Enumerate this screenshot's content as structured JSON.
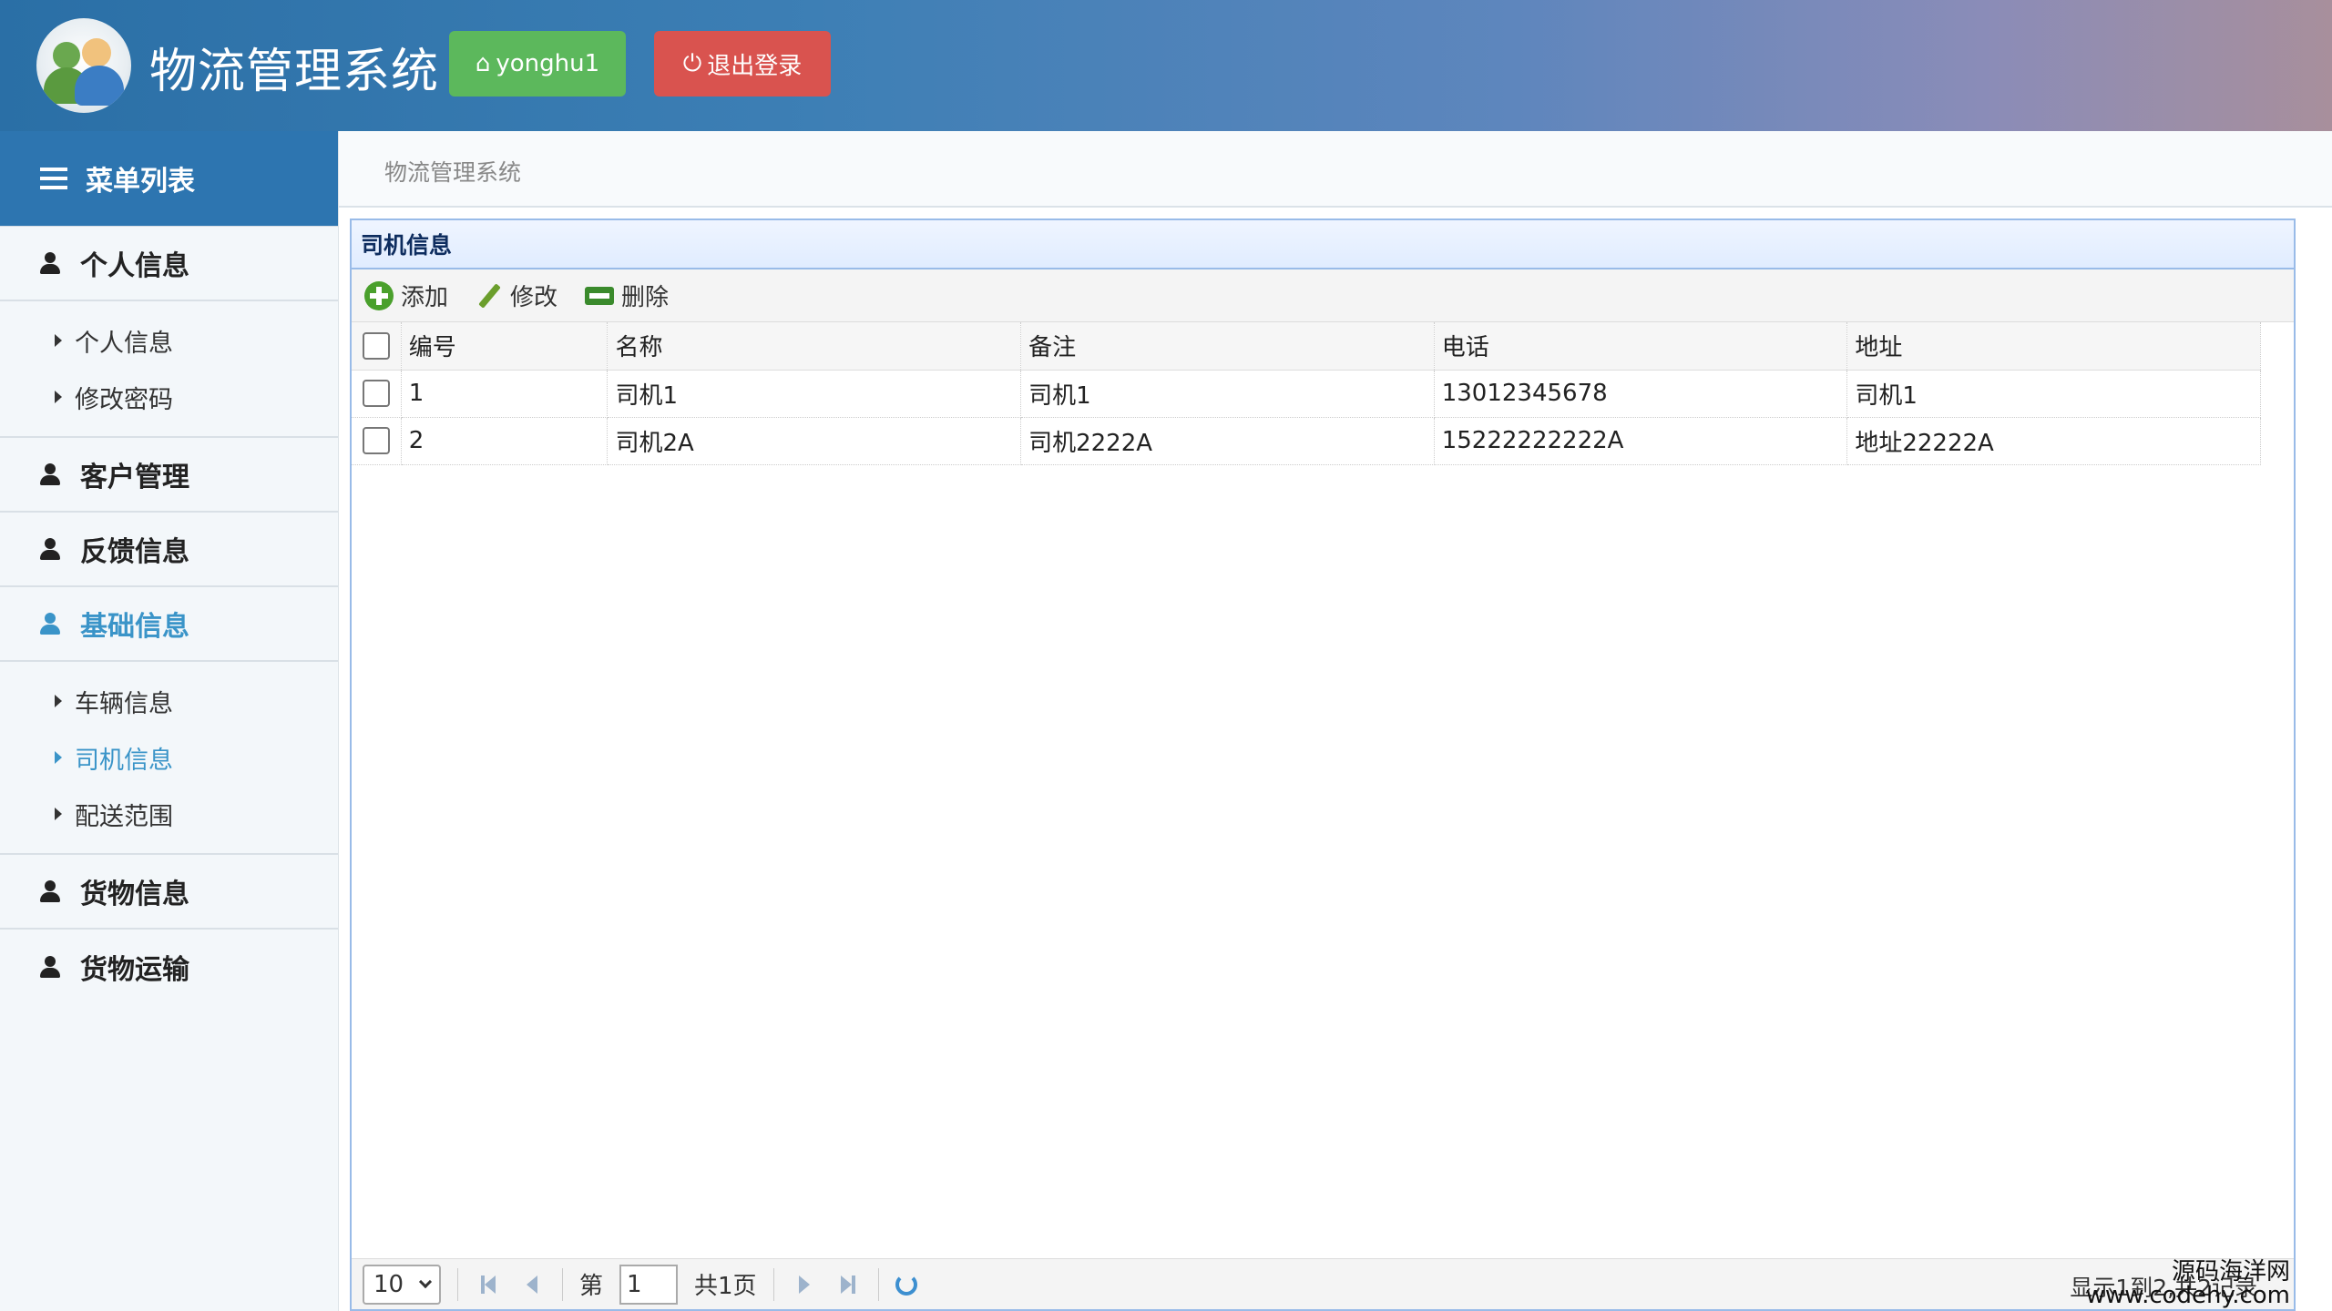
{
  "header": {
    "app_title": "物流管理系统",
    "user_button": "yonghu1",
    "logout_button": "退出登录"
  },
  "sidebar": {
    "menu_title": "菜单列表",
    "groups": [
      {
        "label": "个人信息",
        "items": [
          "个人信息",
          "修改密码"
        ]
      },
      {
        "label": "客户管理"
      },
      {
        "label": "反馈信息"
      },
      {
        "label": "基础信息",
        "active": true,
        "items": [
          "车辆信息",
          "司机信息",
          "配送范围"
        ],
        "active_item": "司机信息"
      },
      {
        "label": "货物信息"
      },
      {
        "label": "货物运输"
      }
    ]
  },
  "breadcrumb": "物流管理系统",
  "panel": {
    "title": "司机信息",
    "toolbar": {
      "add": "添加",
      "edit": "修改",
      "delete": "删除"
    },
    "columns": [
      "编号",
      "名称",
      "备注",
      "电话",
      "地址"
    ],
    "rows": [
      [
        "1",
        "司机1",
        "司机1",
        "13012345678",
        "司机1"
      ],
      [
        "2",
        "司机2A",
        "司机2222A",
        "15222222222A",
        "地址22222A"
      ]
    ]
  },
  "pager": {
    "page_size": "10",
    "page_prefix": "第",
    "page_value": "1",
    "page_total": "共1页",
    "info": "显示1到2,共2记录"
  },
  "watermark": {
    "line1": "源码海洋网",
    "line2": "www.codehy.com"
  },
  "colors": {
    "header_start": "#2a6fa6",
    "user_btn": "#5cb85c",
    "logout_btn": "#d9534f",
    "active": "#3a94c8"
  }
}
